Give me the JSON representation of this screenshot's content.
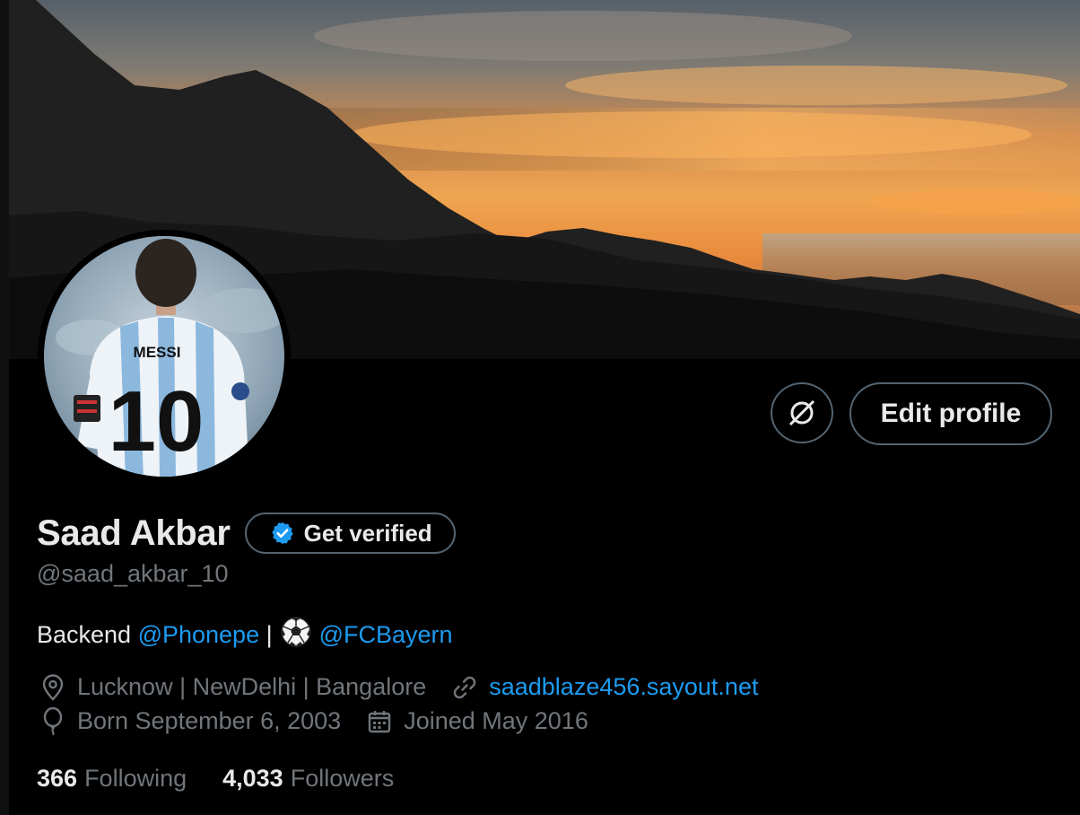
{
  "profile": {
    "display_name": "Saad Akbar",
    "handle": "@saad_akbar_10",
    "verify_label": "Get verified",
    "edit_label": "Edit profile",
    "jersey_name": "MESSI",
    "jersey_number": "10"
  },
  "bio": {
    "prefix": "Backend ",
    "mention_1": "@Phonepe",
    "separator": " |",
    "mention_2": "@FCBayern"
  },
  "meta": {
    "location": "Lucknow | NewDelhi | Bangalore",
    "website": "saadblaze456.sayout.net",
    "birthday": "Born September 6, 2003",
    "joined": "Joined May 2016"
  },
  "stats": {
    "following_count": "366",
    "following_label": "Following",
    "followers_count": "4,033",
    "followers_label": "Followers"
  },
  "icons": {
    "location": "location-pin-icon",
    "website": "link-icon",
    "birthday": "balloon-icon",
    "joined": "calendar-icon",
    "verified": "verified-badge-icon",
    "soccer": "soccer-ball-icon",
    "circle_button": "circle-slash-icon"
  },
  "colors": {
    "background": "#000000",
    "text_primary": "#e7e9ea",
    "text_secondary": "#71767b",
    "link": "#1d9bf0",
    "border": "#536471"
  }
}
